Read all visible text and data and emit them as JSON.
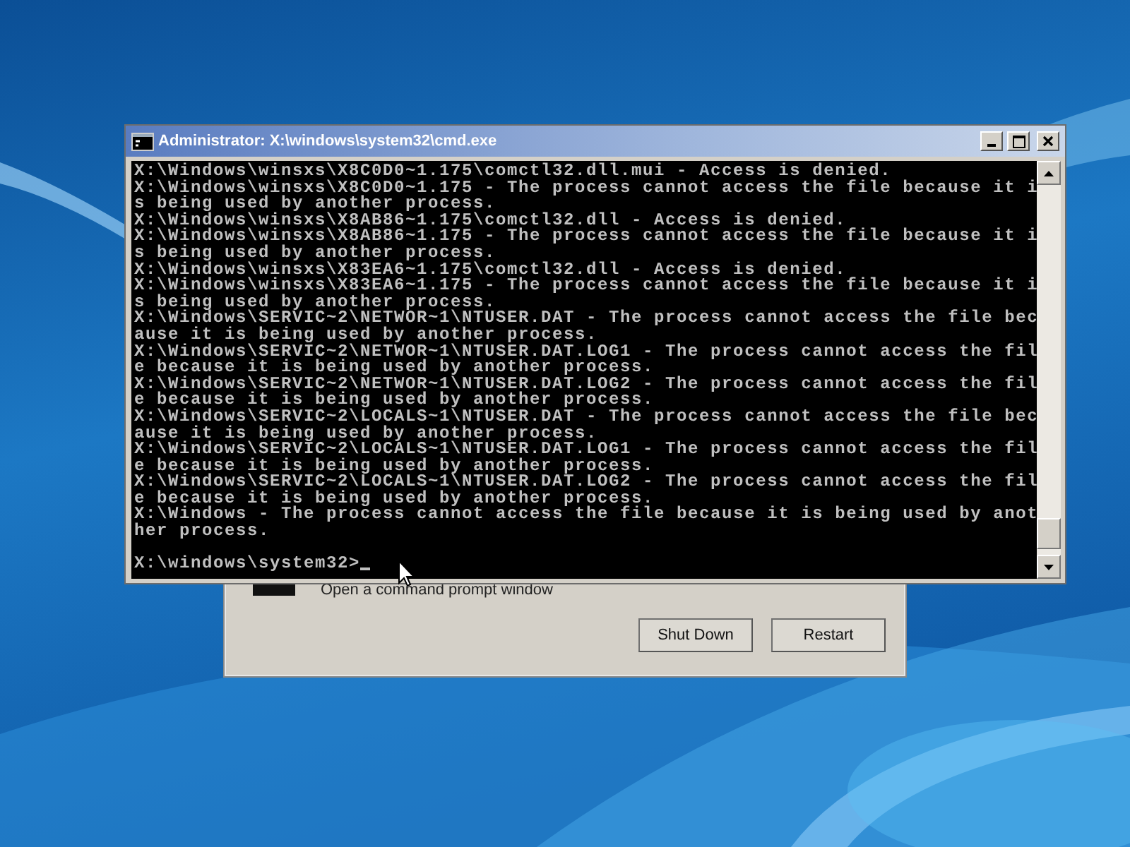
{
  "dialog": {
    "option": {
      "label": "Open a command prompt window"
    },
    "buttons": [
      {
        "label": "Shut Down"
      },
      {
        "label": "Restart"
      }
    ]
  },
  "console": {
    "title": "Administrator: X:\\windows\\system32\\cmd.exe",
    "lines": [
      "X:\\Windows\\winsxs\\X8C0D0~1.175\\comctl32.dll.mui - Access is denied.",
      "X:\\Windows\\winsxs\\X8C0D0~1.175 - The process cannot access the file because it i",
      "s being used by another process.",
      "X:\\Windows\\winsxs\\X8AB86~1.175\\comctl32.dll - Access is denied.",
      "X:\\Windows\\winsxs\\X8AB86~1.175 - The process cannot access the file because it i",
      "s being used by another process.",
      "X:\\Windows\\winsxs\\X83EA6~1.175\\comctl32.dll - Access is denied.",
      "X:\\Windows\\winsxs\\X83EA6~1.175 - The process cannot access the file because it i",
      "s being used by another process.",
      "X:\\Windows\\SERVIC~2\\NETWOR~1\\NTUSER.DAT - The process cannot access the file bec",
      "ause it is being used by another process.",
      "X:\\Windows\\SERVIC~2\\NETWOR~1\\NTUSER.DAT.LOG1 - The process cannot access the fil",
      "e because it is being used by another process.",
      "X:\\Windows\\SERVIC~2\\NETWOR~1\\NTUSER.DAT.LOG2 - The process cannot access the fil",
      "e because it is being used by another process.",
      "X:\\Windows\\SERVIC~2\\LOCALS~1\\NTUSER.DAT - The process cannot access the file bec",
      "ause it is being used by another process.",
      "X:\\Windows\\SERVIC~2\\LOCALS~1\\NTUSER.DAT.LOG1 - The process cannot access the fil",
      "e because it is being used by another process.",
      "X:\\Windows\\SERVIC~2\\LOCALS~1\\NTUSER.DAT.LOG2 - The process cannot access the fil",
      "e because it is being used by another process.",
      "X:\\Windows - The process cannot access the file because it is being used by anot",
      "her process."
    ],
    "prompt": "X:\\windows\\system32>"
  }
}
